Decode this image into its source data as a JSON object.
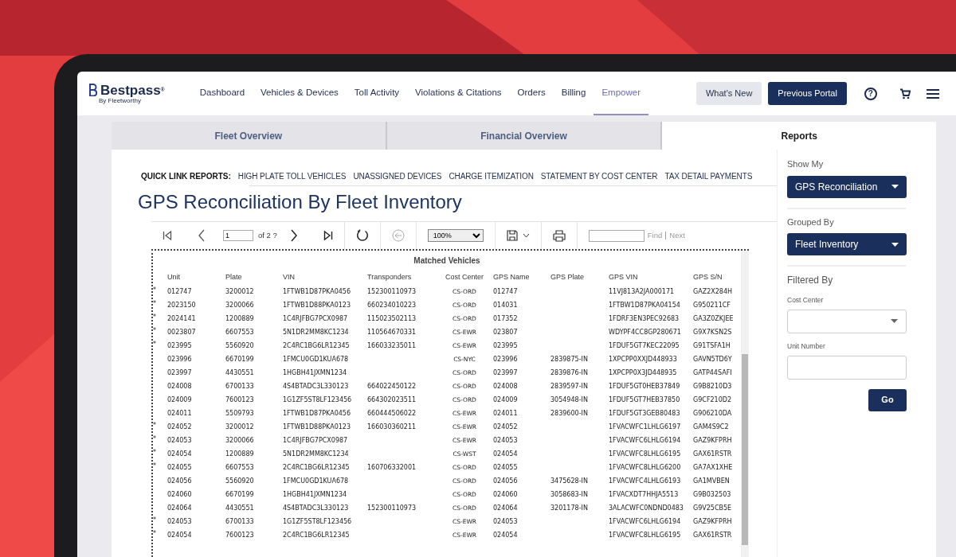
{
  "brand": {
    "name": "Bestpass",
    "mark": "®",
    "tagline": "By Fleetworthy"
  },
  "nav": [
    {
      "label": "Dashboard",
      "selected": false
    },
    {
      "label": "Vehicles & Devices",
      "selected": false
    },
    {
      "label": "Toll Activity",
      "selected": false
    },
    {
      "label": "Violations & Citations",
      "selected": false
    },
    {
      "label": "Orders",
      "selected": false
    },
    {
      "label": "Billing",
      "selected": false
    },
    {
      "label": "Empower",
      "selected": true
    }
  ],
  "header_buttons": [
    "What's New",
    "Previous Portal"
  ],
  "help_glyph": "?",
  "tabs": [
    {
      "label": "Fleet Overview",
      "selected": false
    },
    {
      "label": "Financial Overview",
      "selected": false
    },
    {
      "label": "Reports",
      "selected": true
    }
  ],
  "quick_links": {
    "label": "QUICK LINK REPORTS:",
    "links": [
      "HIGH PLATE TOLL VEHICLES",
      "UNASSIGNED DEVICES",
      "CHARGE ITEMIZATION",
      "STATEMENT BY COST CENTER",
      "TAX DETAIL PAYMENTS"
    ]
  },
  "report_title": "GPS Reconciliation By Fleet Inventory",
  "toolbar": {
    "page": "1",
    "page_of": "of 2 ?",
    "zoom": "100%",
    "find": "Find",
    "next": "Next"
  },
  "table": {
    "title": "Matched Vehicles",
    "columns": [
      "Unit",
      "Plate",
      "VIN",
      "Transponders",
      "Cost Center",
      "GPS Name",
      "GPS Plate",
      "GPS VIN",
      "GPS S/N"
    ],
    "rows": [
      {
        "marker": "*",
        "cells": [
          "012747",
          "3200012",
          "1FTWB1D87PKA0456",
          "152300110973",
          "CS-ORD",
          "012747",
          "",
          "11VJ813A2JA000171",
          "GAZ2X284H"
        ]
      },
      {
        "marker": "*",
        "cells": [
          "2023150",
          "3200066",
          "1FTWB1D88PKA0123",
          "660234010223",
          "CS-ORD",
          "014031",
          "",
          "1FTBW1D87PKA04154",
          "G950211CF"
        ]
      },
      {
        "marker": "*",
        "cells": [
          "2024141",
          "1200889",
          "1C4RJFBG7PCX0987",
          "115023502113",
          "CS-ORD",
          "017352",
          "",
          "1FDRF3EN3PEC92683",
          "GA3Z0ZKJEE"
        ]
      },
      {
        "marker": "*",
        "cells": [
          "0023807",
          "6607553",
          "5N1DR2MM8KC1234",
          "110564670331",
          "CS-EWR",
          "023807",
          "",
          "WDYPF4CC8GP280671",
          "G9X7KSN2S"
        ]
      },
      {
        "marker": "*",
        "cells": [
          "023995",
          "5560920",
          "2C4RC1BG6LR12345",
          "166033235011",
          "CS-EWR",
          "023995",
          "",
          "1FDUF5GT7KEC22095",
          "G91TSFA1H"
        ]
      },
      {
        "marker": "",
        "cells": [
          "023996",
          "6670199",
          "1FMCU0GD1KUA678",
          "",
          "CS-NYC",
          "023996",
          "2839875-IN",
          "1XPCPP0XXJD448933",
          "GAVN5TD6Y"
        ]
      },
      {
        "marker": "",
        "cells": [
          "023997",
          "4430551",
          "1HGBH41JXMN1234",
          "",
          "CS-ORD",
          "023997",
          "2839876-IN",
          "1XPCPP0X3JD448935",
          "GATP44SAFI"
        ]
      },
      {
        "marker": "",
        "cells": [
          "024008",
          "6700133",
          "4S4BTADC3L330123",
          "664022450122",
          "CS-ORD",
          "024008",
          "2839597-IN",
          "1FDUF5GT0HEB37849",
          "G9B8210D3"
        ]
      },
      {
        "marker": "",
        "cells": [
          "024009",
          "7600123",
          "1G1ZF5ST8LF123456",
          "664302023511",
          "CS-ORD",
          "024009",
          "3054948-IN",
          "1FDUF5GT7HEB37850",
          "G9CF210D2"
        ]
      },
      {
        "marker": "",
        "cells": [
          "024011",
          "5509793",
          "1FTWB1D87PKA0456",
          "660444506022",
          "CS-EWR",
          "024011",
          "2839600-IN",
          "1FDUF5GT3GEB80483",
          "G906210DA"
        ]
      },
      {
        "marker": "*",
        "cells": [
          "024052",
          "3200012",
          "1FTWB1D88PKA0123",
          "166030360211",
          "CS-EWR",
          "024052",
          "",
          "1FVACWFC1LHLG6197",
          "GAM4S9C2"
        ]
      },
      {
        "marker": "*",
        "cells": [
          "024053",
          "3200066",
          "1C4RJFBG7PCX0987",
          "",
          "CS-EWR",
          "024053",
          "",
          "1FVACWFC6LHLG6194",
          "GAZ9KFPRH"
        ]
      },
      {
        "marker": "*",
        "cells": [
          "024054",
          "1200889",
          "5N1DR2MM8KC1234",
          "",
          "CS-WST",
          "024054",
          "",
          "1FVACWFC8LHLG6195",
          "GAX61RSTR"
        ]
      },
      {
        "marker": "*",
        "cells": [
          "024055",
          "6607553",
          "2C4RC1BG6LR12345",
          "160706332001",
          "CS-ORD",
          "024055",
          "",
          "1FVACWFC8LHLG6200",
          "GA7AX1XHE"
        ]
      },
      {
        "marker": "",
        "cells": [
          "024056",
          "5560920",
          "1FMCU0GD1KUA678",
          "",
          "CS-ORD",
          "024056",
          "3475628-IN",
          "1FVACWFC4LHLG6193",
          "GA1MVBEN"
        ]
      },
      {
        "marker": "",
        "cells": [
          "024060",
          "6670199",
          "1HGBH41JXMN1234",
          "",
          "CS-ORD",
          "024060",
          "3058683-IN",
          "1FVACXDT7HHJA5513",
          "G9B032503"
        ]
      },
      {
        "marker": "",
        "cells": [
          "024064",
          "4430551",
          "4S4BTADC3L330123",
          "152300110973",
          "CS-ORD",
          "024064",
          "3201178-IN",
          "3ALACWFC0NDND0483",
          "G9V25CB5E"
        ]
      },
      {
        "marker": "*",
        "cells": [
          "024053",
          "6700133",
          "1G1ZF5ST8LF123456",
          "",
          "CS-EWR",
          "024053",
          "",
          "1FVACWFC6LHLG6194",
          "GAZ9KFPRH"
        ]
      },
      {
        "marker": "*",
        "cells": [
          "024054",
          "7600123",
          "2C4RC1BG6LR12345",
          "",
          "CS-EWR",
          "024054",
          "",
          "1FVACWFC8LHLG6195",
          "GAX61RSTR"
        ]
      }
    ]
  },
  "sidebar": {
    "show_my": {
      "label": "Show My",
      "value": "GPS Reconciliation"
    },
    "grouped_by": {
      "label": "Grouped By",
      "value": "Fleet Inventory"
    },
    "filtered_by": "Filtered By",
    "cost_center_label": "Cost Center",
    "unit_number_label": "Unit Number",
    "go": "Go"
  }
}
